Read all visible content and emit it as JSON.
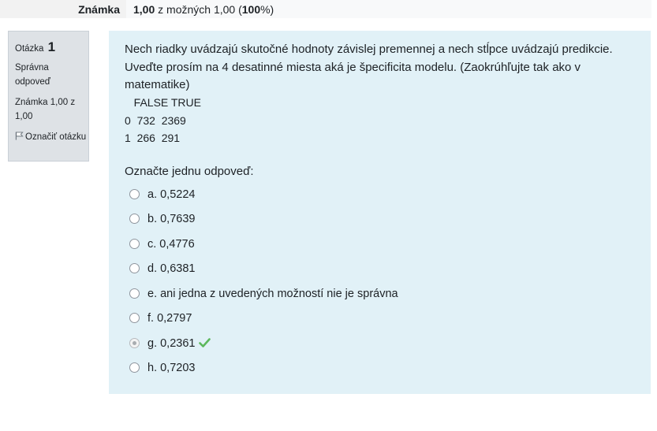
{
  "grade_row": {
    "label": "Známka",
    "value_bold": "1,00",
    "value_mid": " z možných 1,00 (",
    "percent_bold": "100",
    "value_end": "%)"
  },
  "info": {
    "question_word": "Otázka",
    "question_number": "1",
    "state": "Správna odpoveď",
    "grade": "Známka 1,00 z 1,00",
    "flag_label": "Označiť otázku",
    "flag_icon": "flag-icon"
  },
  "question": {
    "text": "Nech riadky uvádzajú skutočné hodnoty závislej premennej a nech stĺpce uvádzajú predikcie. Uveďte prosím na 4 desatinné miesta aká je špecificita modelu. (Zaokrúhľujte tak ako v matematike)",
    "table_lines": [
      "   FALSE TRUE",
      "0  732  2369",
      "1  266  291"
    ],
    "prompt": "Označte jednu odpoveď:",
    "options": [
      {
        "label": "a. 0,5224",
        "checked": false,
        "correct": false
      },
      {
        "label": "b. 0,7639",
        "checked": false,
        "correct": false
      },
      {
        "label": "c. 0,4776",
        "checked": false,
        "correct": false
      },
      {
        "label": "d. 0,6381",
        "checked": false,
        "correct": false
      },
      {
        "label": "e. ani jedna z uvedených možností nie je správna",
        "checked": false,
        "correct": false
      },
      {
        "label": "f. 0,2797",
        "checked": false,
        "correct": false
      },
      {
        "label": "g. 0,2361",
        "checked": true,
        "correct": true
      },
      {
        "label": "h. 0,7203",
        "checked": false,
        "correct": false
      }
    ],
    "correct_icon": "checkmark-icon",
    "correct_color": "#5cb85c"
  }
}
